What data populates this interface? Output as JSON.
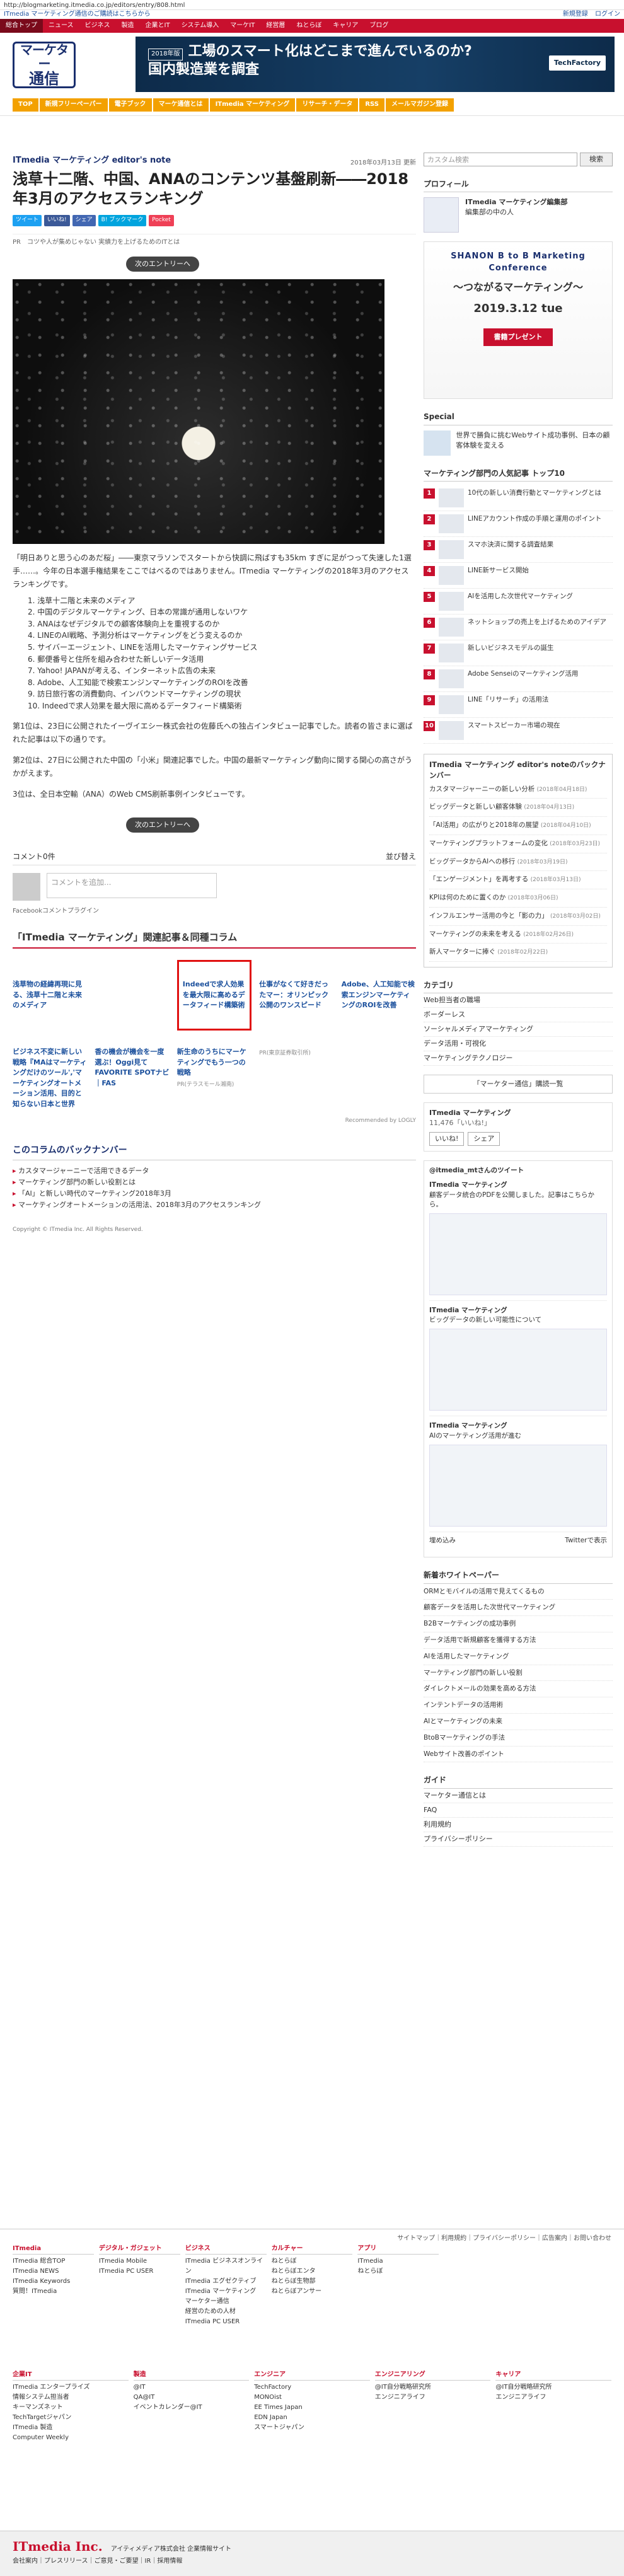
{
  "top": {
    "url": "http://blogmarketing.itmedia.co.jp/editors/entry/808.html",
    "notice": "ITmedia マーケティング通信のご購読はこちらから",
    "user_links": [
      "新規登録",
      "ログイン"
    ]
  },
  "nav": {
    "items": [
      "総合トップ",
      "ニュース",
      "ビジネス",
      "製造",
      "企業とIT",
      "システム導入",
      "マーケIT",
      "経営層",
      "ねとらぼ",
      "キャリア",
      "ブログ"
    ]
  },
  "header": {
    "logo_line1": "マーケター",
    "logo_line2": "通信",
    "banner_tag": "2018年版",
    "banner_line1": "工場のスマート化はどこまで進んでいるのか?",
    "banner_line2": "国内製造業を調査",
    "banner_brand": "TechFactory"
  },
  "subnav": {
    "items": [
      "TOP",
      "新規フリーペーパー",
      "電子ブック",
      "マーケ通信とは",
      "ITmedia マーケティング",
      "リサーチ・データ",
      "RSS",
      "メールマガジン登録"
    ]
  },
  "article": {
    "series": "ITmedia マーケティング editor's note",
    "date": "2018年03月13日 更新",
    "title": "浅草十二階、中国、ANAのコンテンツ基盤刷新――2018年3月のアクセスランキング",
    "social": [
      "ツイート",
      "いいね!",
      "シェア",
      "B! ブックマーク",
      "Pocket"
    ],
    "crumb": "PR　コツや人が集めじゃない 実績力を上げるためのITとは",
    "next_label": "次のエントリーへ",
    "paragraphs": [
      "「明日ありと思う心のあだ桜」――東京マラソンでスタートから快調に飛ばすも35km すぎに足がつって失速した1選手……。今年の日本選手権結果をここではべるのではありません。ITmedia マーケティングの2018年3月のアクセスランキングです。",
      "第1位は、23日に公開されたイーヴイエシー株式会社の佐藤氏への独占インタビュー記事でした。読者の皆さまに選ばれた記事は以下の通りです。",
      "第2位は、27日に公開された中国の「小米」関連記事でした。中国の最新マーケティング動向に関する関心の高さがうかがえます。",
      "3位は、全日本空輸（ANA）のWeb CMS刷新事例インタビューです。"
    ],
    "list": [
      "1. 浅草十二階と未来のメディア",
      "2. 中国のデジタルマーケティング、日本の常識が通用しないワケ",
      "3. ANAはなぜデジタルでの顧客体験向上を重視するのか",
      "4. LINEのAI戦略、予測分析はマーケティングをどう変えるのか",
      "5. サイバーエージェント、LINEを活用したマーケティングサービス",
      "6. 郵便番号と住所を組み合わせた新しいデータ活用",
      "7. Yahoo! JAPANが考える、インターネット広告の未来",
      "8. Adobe、人工知能で検索エンジンマーケティングのROIを改善",
      "9. 訪日旅行客の消費動向、インバウンドマーケティングの現状",
      "10. Indeedで求人効果を最大限に高めるデータフィード構築術"
    ],
    "comments_label": "コメント0件",
    "sort_label": "並び替え",
    "comment_placeholder": "コメントを追加...",
    "plugin_label": "Facebookコメントプラグイン"
  },
  "related": {
    "heading": "「ITmedia マーケティング」関連記事＆同種コラム",
    "row1": [
      "浅草物の経緯再現に見る、浅草十二階と未来のメディア",
      "",
      "Indeedで求人効果を最大限に高めるデータフィード構築術",
      "仕事がなくて好きだったマー：オリンピック 公開のワンスピード",
      "Adobe、人工知能で検索エンジンマーケティングのROIを改善"
    ],
    "row2": [
      "ビジネス不変に新しい戦略『MAはマーケティングだけのツール','マーケティングオートメーション活用、目的と知らない日本と世界",
      "香の機会が機会を一度選ぶ！Oggi見てFAVORITE SPOTナビ｜FAS",
      "新生命のうちにマーケティングでもう一つの戦略"
    ],
    "row2_src": [
      "",
      "",
      "PR(テラスモール湘南)",
      "PR(東京証券取引所)",
      ""
    ],
    "reco": "Recommended by LOGLY"
  },
  "backnumber": {
    "heading": "このコラムのバックナンバー",
    "items": [
      "カスタマージャーニーで活用できるデータ",
      "マーケティング部門の新しい役割とは",
      "「AI」と新しい時代のマーケティング2018年3月",
      "マーケティングオートメーションの活用法、2018年3月のアクセスランキング"
    ]
  },
  "copyright": "Copyright © ITmedia Inc. All Rights Reserved.",
  "side": {
    "search_placeholder": "カスタム検索",
    "search_button": "検索",
    "profile_title": "プロフィール",
    "profile_name": "ITmedia マーケティング編集部",
    "profile_desc": "編集部の中の人",
    "ad_title": "SHANON B to B Marketing Conference",
    "ad_subtitle": "〜つながるマーケティング〜",
    "ad_date": "2019.3.12 tue",
    "ad_gift": "書籍プレゼント",
    "special_title": "Special",
    "special_text": "世界で勝負に挑むWebサイト成功事例、日本の顧客体験を変える",
    "rank_title": "マーケティング部門の人気記事 トップ10",
    "rank": [
      "10代の新しい消費行動とマーケティングとは",
      "LINEアカウント作成の手順と運用のポイント",
      "スマホ決済に関する調査結果",
      "LINE新サービス開始",
      "AIを活用した次世代マーケティング",
      "ネットショップの売上を上げるためのアイデア",
      "新しいビジネスモデルの誕生",
      "Adobe Senseiのマーケティング活用",
      "LINE「リサーチ」の活用法",
      "スマートスピーカー市場の現在"
    ],
    "bk_title": "ITmedia マーケティング editor's noteのバックナンバー",
    "bk": [
      {
        "t": "カスタマージャーニーの新しい分析",
        "d": "(2018年04月18日)"
      },
      {
        "t": "ビッグデータと新しい顧客体験",
        "d": "(2018年04月13日)"
      },
      {
        "t": "「AI活用」の広がりと2018年の展望",
        "d": "(2018年04月10日)"
      },
      {
        "t": "マーケティングプラットフォームの変化",
        "d": "(2018年03月23日)"
      },
      {
        "t": "ビッグデータからAIへの移行",
        "d": "(2018年03月19日)"
      },
      {
        "t": "「エンゲージメント」を再考する",
        "d": "(2018年03月13日)"
      },
      {
        "t": "KPIは何のために置くのか",
        "d": "(2018年03月06日)"
      },
      {
        "t": "インフルエンサー活用の今と「影の力」",
        "d": "(2018年03月02日)"
      },
      {
        "t": "マーケティングの未来を考える",
        "d": "(2018年02月26日)"
      },
      {
        "t": "新人マーケターに捧ぐ",
        "d": "(2018年02月22日)"
      }
    ],
    "cat_title": "カテゴリ",
    "cats": [
      "Web担当者の職場",
      "ボーダーレス",
      "ソーシャルメディアマーケティング",
      "データ活用・可視化",
      "マーケティングテクノロジー"
    ],
    "bk_btn": "「マーケター通信」購読一覧",
    "fb_title": "ITmedia マーケティング",
    "fb_likes": "11,476「いいね!」",
    "fb_like": "いいね!",
    "fb_share": "シェア",
    "tw_title": "@itmedia_mtさんのツイート",
    "tweets": [
      {
        "name": "ITmedia マーケティング",
        "text": "顧客データ統合のPDFを公開しました。記事はこちらから。"
      },
      {
        "name": "ITmedia マーケティング",
        "text": "ビッグデータの新しい可能性について"
      },
      {
        "name": "ITmedia マーケティング",
        "text": "AIのマーケティング活用が進む"
      }
    ],
    "tw_embed": "埋め込み",
    "tw_view": "Twitterで表示",
    "whitepaper_title": "新着ホワイトペーパー",
    "whitepapers": [
      "ORMとモバイルの活用で見えてくるもの",
      "顧客データを活用した次世代マーケティング",
      "B2Bマーケティングの成功事例",
      "データ活用で新規顧客を獲得する方法",
      "AIを活用したマーケティング",
      "マーケティング部門の新しい役割",
      "ダイレクトメールの効果を高める方法",
      "インテントデータの活用術",
      "AIとマーケティングの未来",
      "BtoBマーケティングの手法",
      "Webサイト改善のポイント"
    ],
    "guide_title": "ガイド",
    "guides": [
      "マーケター通信とは",
      "FAQ",
      "利用規約",
      "プライバシーポリシー"
    ]
  },
  "footer": {
    "links": "サイトマップ｜利用規約｜プライバシーポリシー｜広告案内｜お問い合わせ",
    "cols": [
      {
        "h": "ITmedia",
        "items": [
          "ITmedia 総合TOP",
          "ITmedia NEWS",
          "ITmedia Keywords",
          "質問！ITmedia"
        ]
      },
      {
        "h": "デジタル・ガジェット",
        "items": [
          "ITmedia Mobile",
          "ITmedia PC USER"
        ]
      },
      {
        "h": "ビジネス",
        "items": [
          "ITmedia ビジネスオンライン",
          "ITmedia エグゼクティブ",
          "ITmedia マーケティング",
          "マーケター通信",
          "経営のための人材",
          "ITmedia PC USER"
        ]
      },
      {
        "h": "カルチャー",
        "items": [
          "ねとらぼ",
          "ねとらぼエンタ",
          "ねとらぼ生物部",
          "ねとらぼアンサー"
        ]
      },
      {
        "h": "アプリ",
        "items": [
          "ITmedia",
          "ねとらぼ"
        ]
      }
    ],
    "cols2": [
      {
        "h": "企業IT",
        "items": [
          "ITmedia エンタープライズ",
          "情報システム担当者",
          "キーマンズネット",
          "TechTargetジャパン",
          "ITmedia 製造",
          "Computer Weekly"
        ]
      },
      {
        "h": "製造",
        "items": [
          "@IT",
          "QA@IT",
          "イベントカレンダー@IT"
        ]
      },
      {
        "h": "エンジニア",
        "items": [
          "TechFactory",
          "MONOist",
          "EE Times Japan",
          "EDN Japan",
          "スマートジャパン"
        ]
      },
      {
        "h": "エンジニアリング",
        "items": [
          "@IT自分戦略研究所",
          "エンジニアライフ"
        ]
      },
      {
        "h": "キャリア",
        "items": [
          "@IT自分戦略研究所",
          "エンジニアライフ"
        ]
      }
    ],
    "brand": "ITmedia Inc.",
    "brand_sub": "アイティメディア株式会社 企業情報サイト",
    "brand_links": "会社案内｜プレスリリース｜ご意見・ご要望｜IR｜採用情報"
  }
}
